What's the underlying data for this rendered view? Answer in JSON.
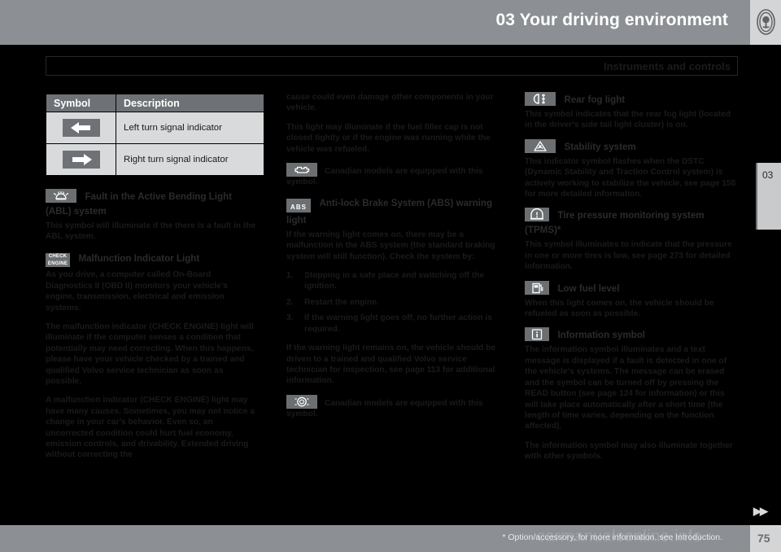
{
  "header": {
    "chapter_number": "03",
    "title": "03 Your driving environment",
    "logo_icon": "volvo-logo-icon"
  },
  "section_bar": {
    "title": "Instruments and controls"
  },
  "side_tab": {
    "label": "03"
  },
  "symbol_table": {
    "columns": [
      "Symbol",
      "Description"
    ],
    "rows": [
      {
        "symbol_icon": "left-turn-arrow-icon",
        "description": "Left turn signal indicator"
      },
      {
        "symbol_icon": "right-turn-arrow-icon",
        "description": "Right turn signal indicator"
      }
    ]
  },
  "column1": {
    "abl": {
      "icon": "bending-light-icon",
      "heading": "Fault in the Active Bending Light (ABL) system",
      "body": "This symbol will illuminate if the there is a fault in the ABL system."
    },
    "mil": {
      "icon": "check-engine-icon",
      "icon_line1": "CHECK",
      "icon_line2": "ENGINE",
      "heading": "Malfunction Indicator Light",
      "para1": "As you drive, a computer called On-Board Diagnostics II (OBD II) monitors your vehicle's engine, transmission, electrical and emission systems.",
      "para2": "The malfunction indicator (CHECK ENGINE) light will illuminate if the computer senses a condition that potentially may need correcting. When this happens, please have your vehicle checked by a trained and qualified Volvo service technician as soon as possible.",
      "para3": "A malfunction indicator (CHECK ENGINE) light may have many causes. Sometimes, you may not notice a change in your car's behavior. Even so, an uncorrected condition could hurt fuel economy, emission controls, and drivability. Extended driving without correcting the"
    }
  },
  "column2": {
    "para_continued": "cause could even damage other components in your vehicle.",
    "para_fuelcap": "This light may illuminate if the fuel filler cap is not closed tightly or if the engine was running while the vehicle was refueled.",
    "canadian_note_1": {
      "icon": "canadian-engine-symbol-icon",
      "text": "Canadian models are equipped with this symbol."
    },
    "abs": {
      "icon": "abs-icon",
      "icon_text": "ABS",
      "heading": "Anti-lock Brake System (ABS) warning light",
      "intro": "If the warning light comes on, there may be a malfunction in the ABS system (the standard braking system will still function). Check the system by:",
      "steps": [
        {
          "num": "1.",
          "text": "Stopping in a safe place and switching off the ignition."
        },
        {
          "num": "2.",
          "text": "Restart the engine."
        },
        {
          "num": "3.",
          "text": "If the warning light goes off, no further action is required."
        }
      ],
      "closing": "If the warning light remains on, the vehicle should be driven to a trained and qualified Volvo service technician for inspection, see page 113 for additional information."
    },
    "canadian_note_2": {
      "icon": "canadian-abs-symbol-icon",
      "text": "Canadian models are equipped with this symbol."
    }
  },
  "column3": {
    "rear_fog": {
      "icon": "rear-fog-light-icon",
      "heading": "Rear fog light",
      "body": "This symbol indicates that the rear fog light (located in the driver's side tail light cluster) is on."
    },
    "stability": {
      "icon": "stability-system-icon",
      "heading": "Stability system",
      "body": "This indicator symbol flashes when the DSTC (Dynamic Stability and Traction Control system) is actively working to stabilize the vehicle, see page 158 for more detailed information."
    },
    "tpms": {
      "icon": "tire-pressure-icon",
      "heading": "Tire pressure monitoring system (TPMS)*",
      "body": "This symbol illuminates to indicate that the pressure in one or more tires is low, see page 273 for detailed information."
    },
    "low_fuel": {
      "icon": "low-fuel-icon",
      "heading": "Low fuel level",
      "body": "When this light comes on, the vehicle should be refueled as soon as possible."
    },
    "info_symbol": {
      "icon": "information-symbol-icon",
      "heading": "Information symbol",
      "para1": "The information symbol illuminates and a text message is displayed if a fault is detected in one of the vehicle's systems. The message can be erased and the symbol can be turned off by pressing the READ button (see page 124 for information) or this will take place automatically after a short time (the length of time varies, depending on the function affected).",
      "para2": "The information symbol may also illuminate together with other symbols."
    }
  },
  "footer": {
    "note": "* Option/accessory, for more information, see Introduction.",
    "page_number": "75",
    "watermark": "carmanualsonline.info",
    "next_arrows": "▶▶"
  }
}
